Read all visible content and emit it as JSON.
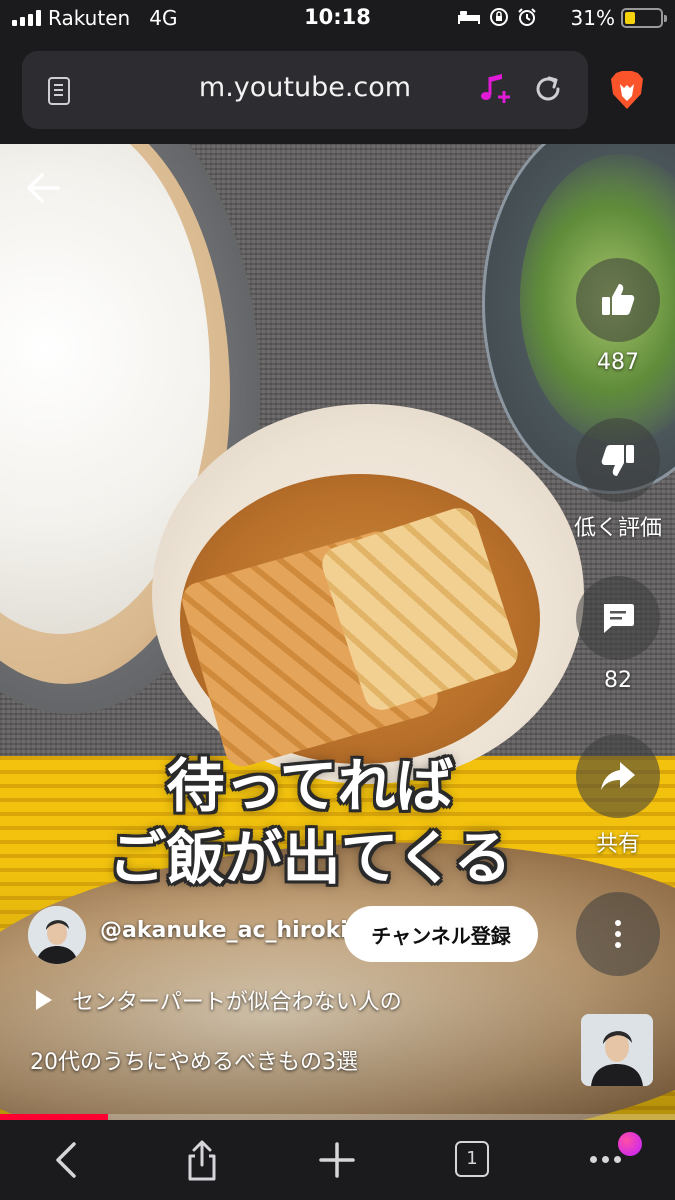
{
  "status_bar": {
    "carrier": "Rakuten",
    "network": "4G",
    "time": "10:18",
    "battery_percent": "31%",
    "battery_level": 0.31
  },
  "browser": {
    "url": "m.youtube.com",
    "tab_count": "1",
    "icons": [
      "reader-icon",
      "music-add-icon",
      "reload-icon",
      "brave-lion-icon",
      "back-icon",
      "share-icon",
      "new-tab-icon",
      "tabs-icon",
      "more-icon"
    ]
  },
  "short": {
    "caption_line1": "待ってれば",
    "caption_line2": "ご飯が出てくる",
    "likes": "487",
    "dislike_label": "低く評価",
    "comments": "82",
    "share_label": "共有",
    "channel": "@akanuke_ac_hiroki",
    "subscribe_label": "チャンネル登録",
    "suggested_line1": "センターパートが似合わない人の",
    "suggested_line2": "20代のうちにやめるべきもの3選",
    "progress": 0.16
  },
  "colors": {
    "browser_chrome": "#1b1b1d",
    "url_pill": "#2d2d31",
    "progress_red": "#ff0033",
    "brave_orange": "#fb542b",
    "music_pink": "#e01ad6"
  }
}
